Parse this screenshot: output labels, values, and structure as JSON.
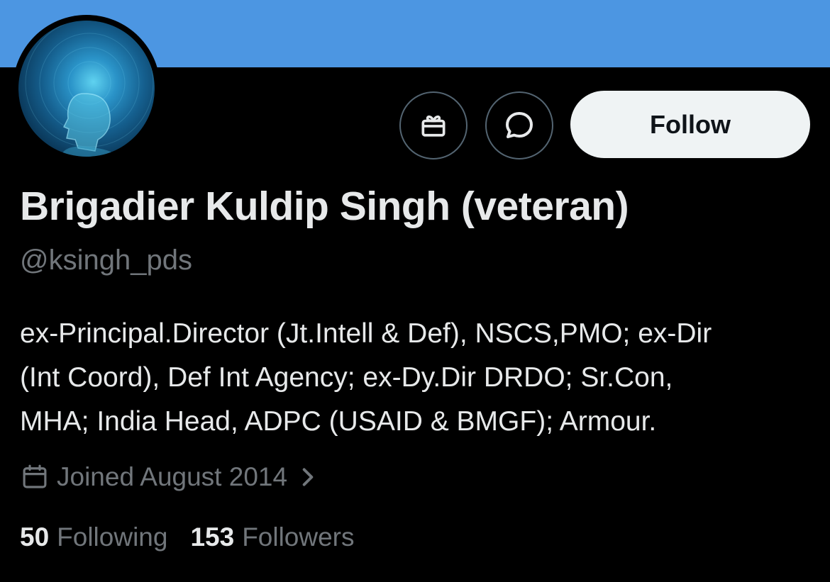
{
  "colors": {
    "banner": "#4c96e2",
    "background": "#000000",
    "primary_text": "#e7e9ea",
    "secondary_text": "#71767b",
    "follow_button_bg": "#eff3f4",
    "follow_button_text": "#0f1419"
  },
  "profile": {
    "display_name": "Brigadier Kuldip Singh (veteran)",
    "handle": "@ksingh_pds",
    "bio_lines": [
      "ex-Principal.Director (Jt.Intell & Def), NSCS,PMO; ex-Dir",
      "(Int Coord), Def Int Agency; ex-Dy.Dir DRDO; Sr.Con,",
      "MHA; India Head, ADPC (USAID & BMGF); Armour."
    ],
    "joined": "Joined August 2014",
    "following_count": "50",
    "following_label": "Following",
    "followers_count": "153",
    "followers_label": "Followers"
  },
  "actions": {
    "follow_label": "Follow",
    "gift_icon": "gift-icon",
    "message_icon": "message-icon"
  },
  "icons": {
    "calendar": "calendar-icon",
    "chevron": "chevron-right-icon",
    "avatar": "digital-head-avatar"
  }
}
